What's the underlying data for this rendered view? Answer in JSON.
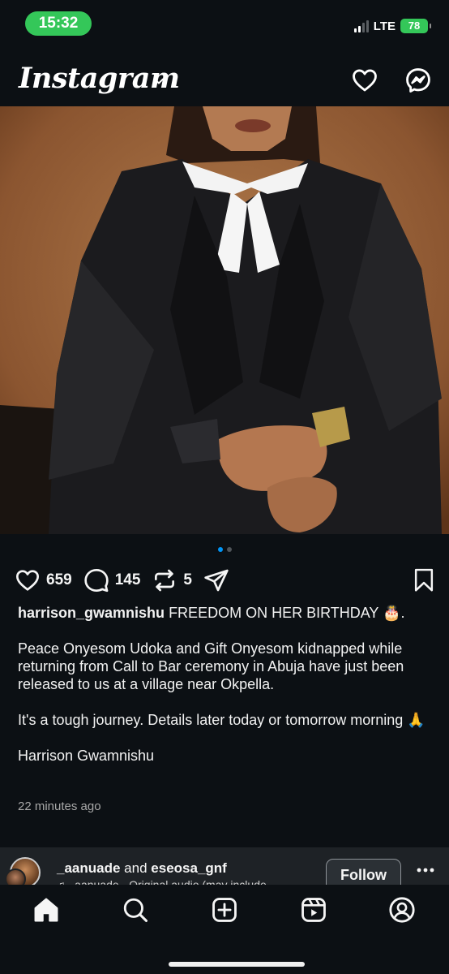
{
  "status_bar": {
    "time": "15:32",
    "network": "LTE",
    "battery": "78"
  },
  "header": {
    "logo": "Instagram",
    "icons": [
      "chevron-down-icon",
      "heart-icon",
      "messenger-icon"
    ]
  },
  "post": {
    "carousel": {
      "count": 2,
      "active_index": 0
    },
    "likes": "659",
    "comments": "145",
    "reposts": "5",
    "username": "harrison_gwamnishu",
    "caption_headline": "FREEDOM ON HER BIRTHDAY",
    "caption_emoji": "🎂",
    "caption_headline_end": ".",
    "paragraphs": [
      "Peace Onyesom Udoka and Gift Onyesom kidnapped while returning from Call to Bar ceremony in Abuja have just been released to us at a village near Okpella.",
      "It's a tough journey.  Details later today or tomorrow morning 🙏",
      "Harrison Gwamnishu"
    ],
    "time_ago": "22 minutes ago"
  },
  "next_post": {
    "user1": "_aanuade",
    "joiner": "and",
    "user2": "eseosa_gnf",
    "subtitle": "♫ _aanuade · Original audio (may include",
    "follow_label": "Follow"
  },
  "nav": {
    "items": [
      "home-icon",
      "search-icon",
      "create-icon",
      "reels-icon",
      "profile-icon"
    ]
  },
  "colors": {
    "background": "#0c1014",
    "accent": "#0095f6",
    "status_green": "#34c759"
  }
}
